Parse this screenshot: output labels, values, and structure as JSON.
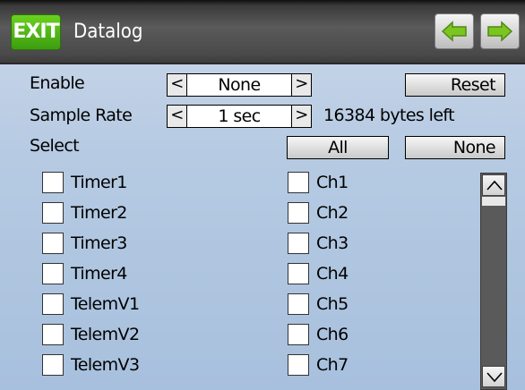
{
  "header": {
    "exit_label": "EXIT",
    "title": "Datalog",
    "prev_icon": "arrow-left-icon",
    "next_icon": "arrow-right-icon",
    "accent_color": "#7ac520"
  },
  "enable": {
    "label": "Enable",
    "value": "None",
    "left_arrow": "<",
    "right_arrow": ">",
    "reset_label": "Reset"
  },
  "sample_rate": {
    "label": "Sample Rate",
    "value": "1 sec",
    "left_arrow": "<",
    "right_arrow": ">",
    "bytes_left": "16384 bytes left"
  },
  "select": {
    "label": "Select",
    "all_label": "All",
    "none_label": "None"
  },
  "left_items": [
    {
      "label": "Timer1",
      "checked": false
    },
    {
      "label": "Timer2",
      "checked": false
    },
    {
      "label": "Timer3",
      "checked": false
    },
    {
      "label": "Timer4",
      "checked": false
    },
    {
      "label": "TelemV1",
      "checked": false
    },
    {
      "label": "TelemV2",
      "checked": false
    },
    {
      "label": "TelemV3",
      "checked": false
    }
  ],
  "right_items": [
    {
      "label": "Ch1",
      "checked": false
    },
    {
      "label": "Ch2",
      "checked": false
    },
    {
      "label": "Ch3",
      "checked": false
    },
    {
      "label": "Ch4",
      "checked": false
    },
    {
      "label": "Ch5",
      "checked": false
    },
    {
      "label": "Ch6",
      "checked": false
    },
    {
      "label": "Ch7",
      "checked": false
    }
  ],
  "scrollbar": {
    "up_icon": "chevron-up-icon",
    "down_icon": "chevron-down-icon"
  }
}
